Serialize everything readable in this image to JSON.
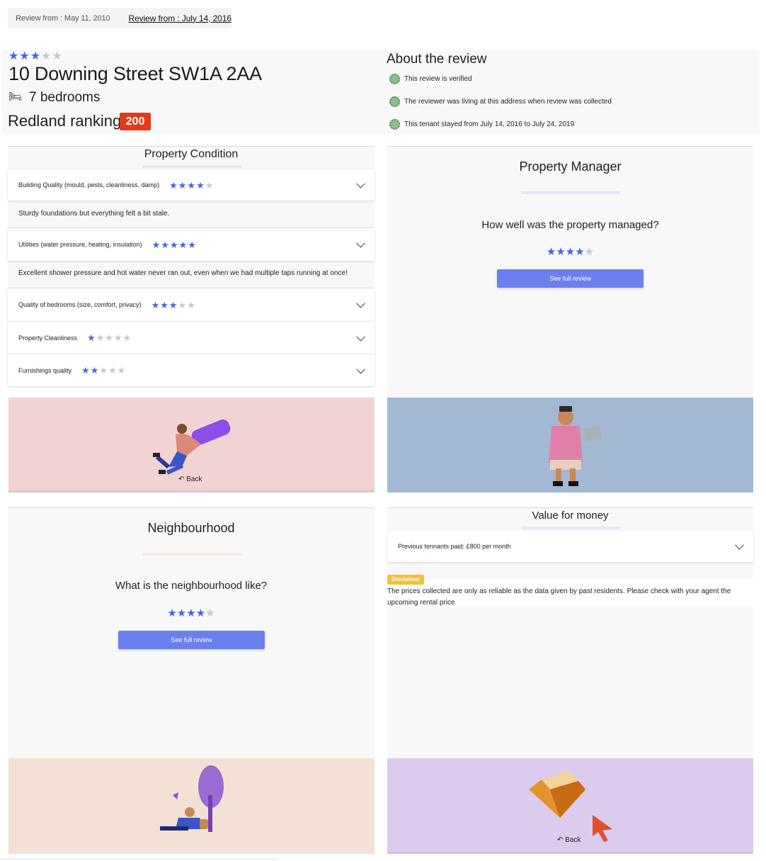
{
  "review_tabs": [
    {
      "label": "Review from : May 11, 2010",
      "active": false
    },
    {
      "label": "Review from : July 14, 2016",
      "active": true
    }
  ],
  "header": {
    "rating": 3,
    "rating_max": 5,
    "address": "10 Downing Street SW1A 2AA",
    "bed_icon": "bed-icon",
    "bedrooms": "7 bedrooms",
    "ranking_label": "Redland ranking:",
    "ranking_value": "200",
    "ranking_color": "#e43a1b"
  },
  "about": {
    "title": "About the review",
    "items": [
      "This review is verified",
      "The reviewer was living at this address when review was collected",
      "This tenant stayed from July 14, 2016 to July 24, 2019"
    ]
  },
  "condition": {
    "title": "Property Condition",
    "items": [
      {
        "label": "Building Quality (mould, pests, cleanliness, damp)",
        "rating": 4,
        "comment": "Sturdy foundations but everything felt a bit stale."
      },
      {
        "label": "Utilities (water pressure, heating, insulation)",
        "rating": 5,
        "comment": "Excellent shower pressure and hot water never ran out, even when we had multiple taps running at once!"
      },
      {
        "label": "Quality of bedrooms (size, comfort, privacy)",
        "rating": 3,
        "comment": ""
      },
      {
        "label": "Property Cleanliness",
        "rating": 1,
        "comment": ""
      },
      {
        "label": "Furnishings quality",
        "rating": 2,
        "comment": ""
      }
    ],
    "back_label": "Back"
  },
  "manager": {
    "title": "Property Manager",
    "question": "How well was the property managed?",
    "rating": 4,
    "button_label": "See full review"
  },
  "neighbourhood": {
    "title": "Neighbourhood",
    "question": "What is the neighbourhood like?",
    "rating": 4,
    "button_label": "See full review"
  },
  "value": {
    "title": "Value for money",
    "price_label": "Previous tennants paid: £800 per month",
    "disclaimer_badge": "Disclaimer",
    "disclaimer_text": "The prices collected are only as reliable as the data given by past residents. Please check with your agent the upcoming rental price",
    "back_label": "Back"
  },
  "colors": {
    "star_on": "#4762e0",
    "star_off": "#c8c8c8",
    "button": "#6b80ef",
    "illus_condition_bg": "#f1d3d4",
    "illus_manager_bg": "#a3b8d3",
    "illus_neighbourhood_bg": "#f4e1d5",
    "illus_value_bg": "#dccbee",
    "disclaimer": "#f1c232"
  }
}
